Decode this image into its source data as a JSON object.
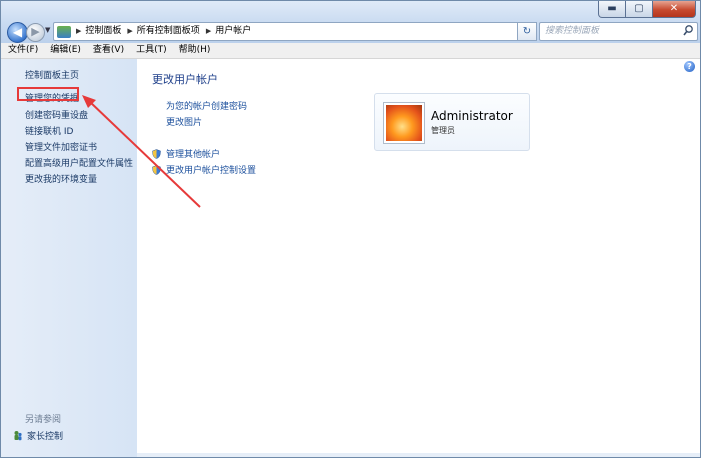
{
  "window": {
    "caption_buttons": {
      "minimize": "▬",
      "maximize": "▢",
      "close": "✕"
    }
  },
  "nav": {
    "back_icon": "back-arrow-icon",
    "forward_icon": "forward-arrow-icon",
    "breadcrumbs": [
      "控制面板",
      "所有控制面板项",
      "用户帐户"
    ],
    "search_placeholder": "搜索控制面板",
    "refresh_symbol": "↻"
  },
  "menubar": {
    "items": [
      "文件(F)",
      "编辑(E)",
      "查看(V)",
      "工具(T)",
      "帮助(H)"
    ]
  },
  "left_pane": {
    "links": [
      "控制面板主页",
      "管理您的凭据",
      "创建密码重设盘",
      "链接联机 ID",
      "管理文件加密证书",
      "配置高级用户配置文件属性",
      "更改我的环境变量"
    ],
    "see_also": "另请参阅",
    "parental_controls": "家长控制"
  },
  "main": {
    "title": "更改用户帐户",
    "links": [
      "为您的帐户创建密码",
      "更改图片"
    ],
    "shield_links": [
      "管理其他帐户",
      "更改用户帐户控制设置"
    ],
    "help_symbol": "?"
  },
  "account": {
    "name": "Administrator",
    "role": "管理员"
  },
  "annotation": {
    "highlight_color": "#e63a3a"
  }
}
